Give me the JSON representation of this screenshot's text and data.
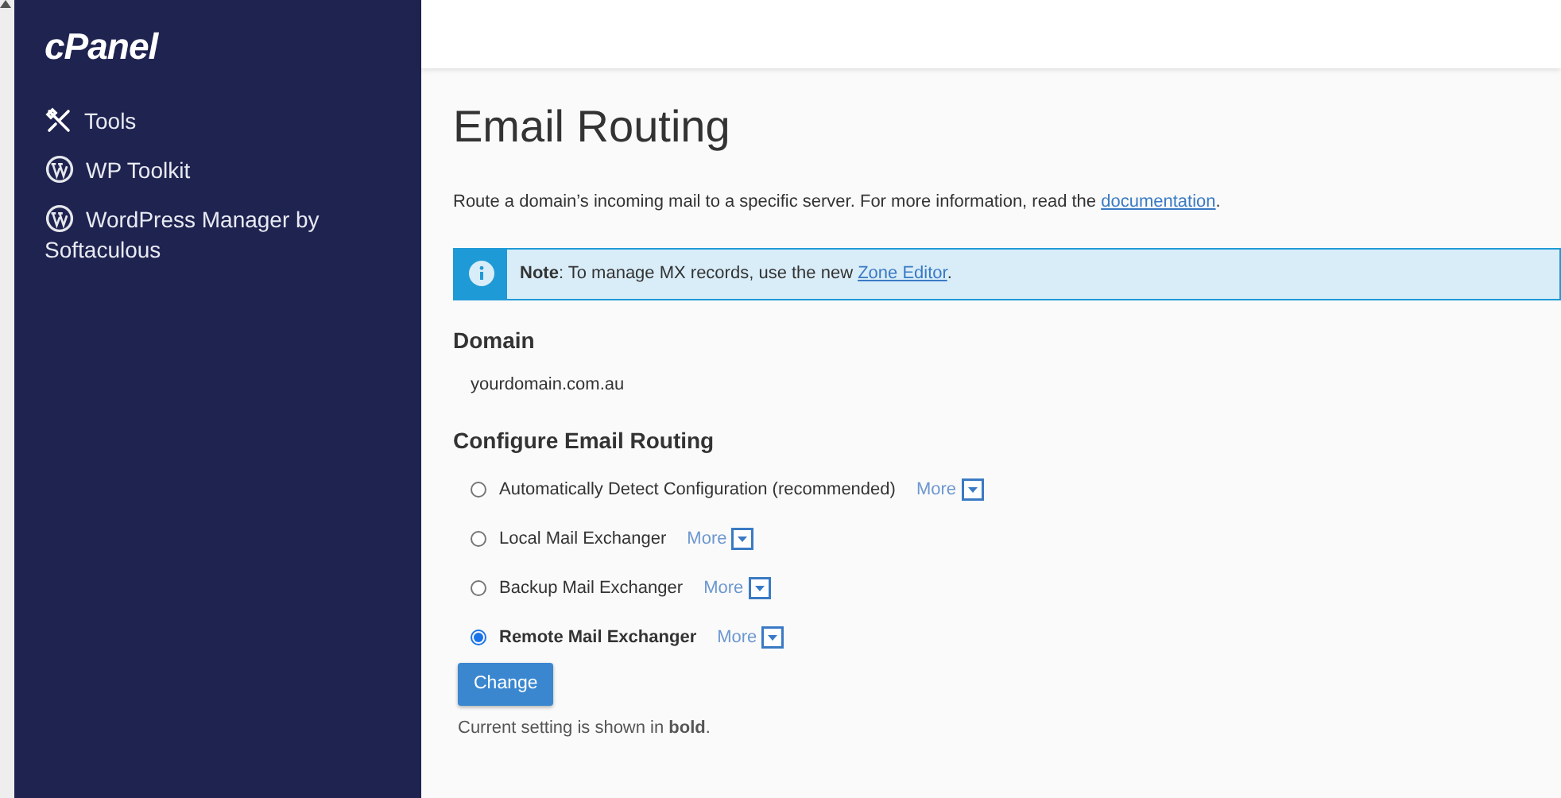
{
  "sidebar": {
    "logo": "cPanel",
    "items": [
      {
        "label": "Tools",
        "kind": "tools"
      },
      {
        "label": "WP Toolkit",
        "kind": "wordpress"
      },
      {
        "label": "WordPress Manager by Softaculous",
        "kind": "wordpress"
      }
    ]
  },
  "title": "Email Routing",
  "description": {
    "text": "Route a domain’s incoming mail to a specific server. For more information, read the ",
    "link": "documentation",
    "after": "."
  },
  "note": {
    "text": "**Note**: To manage MX records, use the new ",
    "link": "Zone Editor",
    "after": "."
  },
  "domain": {
    "heading": "Domain",
    "value": "yourdomain.com.au"
  },
  "routing": {
    "heading": "Configure Email Routing",
    "options": [
      {
        "label": "Automatically Detect Configuration (recommended)",
        "more": "More",
        "selected": false
      },
      {
        "label": "Local Mail Exchanger",
        "more": "More",
        "selected": false
      },
      {
        "label": "Backup Mail Exchanger",
        "more": "More",
        "selected": false
      },
      {
        "label": "Remote Mail Exchanger",
        "more": "More",
        "selected": true
      }
    ],
    "button": "Change",
    "footnote": "Current setting is shown in **bold**."
  }
}
